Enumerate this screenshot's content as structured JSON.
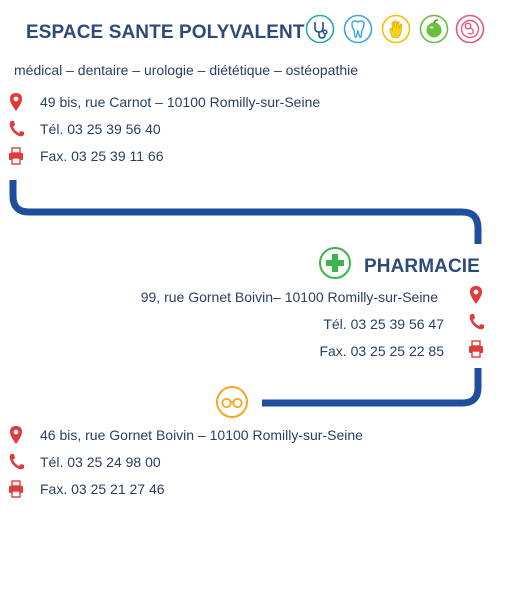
{
  "section1": {
    "title": "ESPACE SANTE POLYVALENT",
    "subtitle": "médical – dentaire – urologie – diététique – ostéopathie",
    "address": "49 bis, rue Carnot – 10100 Romilly-sur-Seine",
    "phone": "Tél. 03 25 39 56 40",
    "fax": "Fax. 03 25 39 11 66",
    "specialty_icons": [
      "stethoscope-icon",
      "tooth-icon",
      "hand-icon",
      "apple-icon",
      "fetus-icon"
    ]
  },
  "section2": {
    "title": "PHARMACIE",
    "address": "99, rue Gornet Boivin– 10100 Romilly-sur-Seine",
    "phone": "Tél. 03 25 39 56 47",
    "fax": "Fax. 03 25 25 22 85",
    "icon": "pharmacy-cross-icon"
  },
  "section3": {
    "address": "46 bis, rue Gornet Boivin – 10100 Romilly-sur-Seine",
    "phone": "Tél. 03 25 24 98 00",
    "fax": "Fax. 03 25 21 27 46",
    "icon": "glasses-icon"
  },
  "colors": {
    "title": "#2e4a7a",
    "text": "#2b3f63",
    "connector": "#1f4f9c",
    "contact_icon": "#e03b3b",
    "pharmacy": "#3cb54a",
    "optician": "#f5a623"
  }
}
